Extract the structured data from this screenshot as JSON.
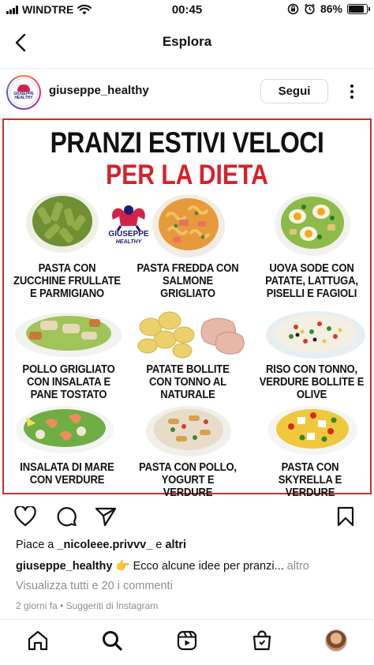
{
  "status_bar": {
    "carrier": "WINDTRE",
    "time": "00:45",
    "battery": "86%",
    "battery_level": 0.86
  },
  "header": {
    "title": "Esplora"
  },
  "post": {
    "username": "giuseppe_healthy",
    "follow_label": "Segui",
    "avatar_text": "GIUSEPPE HEALTHY",
    "poster": {
      "title_line1": "PRANZI ESTIVI VELOCI",
      "title_line2": "PER LA DIETA",
      "logo_text_1": "GIUSEPPE",
      "logo_text_2": "HEALTHY",
      "items": [
        {
          "caption": "PASTA CON ZUCCHINE FRULLATE E PARMIGIANO"
        },
        {
          "caption": "PASTA FREDDA CON SALMONE GRIGLIATO"
        },
        {
          "caption": "UOVA SODE CON PATATE, LATTUGA, PISELLI E FAGIOLI"
        },
        {
          "caption": "POLLO GRIGLIATO CON INSALATA E PANE TOSTATO"
        },
        {
          "caption": "PATATE BOLLITE CON TONNO AL NATURALE"
        },
        {
          "caption": "RISO CON TONNO, VERDURE BOLLITE E OLIVE"
        },
        {
          "caption": "INSALATA DI MARE CON VERDURE"
        },
        {
          "caption": "PASTA CON POLLO, YOGURT E VERDURE"
        },
        {
          "caption": "PASTA CON SKYRELLA E VERDURE"
        }
      ]
    },
    "likes_prefix": "Piace a ",
    "likes_user": "_nicoleee.privvv_",
    "likes_mid": " e ",
    "likes_suffix": "altri",
    "caption_user": "giuseppe_healthy",
    "caption_text": " 👉 Ecco alcune idee per pranzi...",
    "caption_more": " altro",
    "comments_link": "Visualizza tutti e 20 i commenti",
    "time_ago": "2 giorni fa",
    "suggested": "Suggeriti di Instagram"
  },
  "icons": {
    "back": "chevron-left-icon",
    "more": "more-dots-icon",
    "like": "heart-icon",
    "comment": "comment-icon",
    "share": "send-icon",
    "save": "bookmark-icon",
    "home": "home-icon",
    "search": "search-icon",
    "reels": "reels-icon",
    "shop": "shop-icon"
  },
  "colors": {
    "poster_border": "#c9302c",
    "poster_red": "#d81f2a"
  }
}
